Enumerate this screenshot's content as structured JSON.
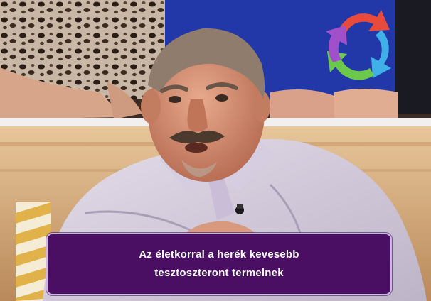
{
  "icons": {
    "logo": "recycle-arrows-icon"
  },
  "colors": {
    "subtitle_background": "#4a0f63",
    "subtitle_border": "#c9b8e6",
    "subtitle_text": "#ffffff"
  },
  "subtitle": {
    "line1": "Az életkorral a herék kevesebb",
    "line2": "tesztoszteront termelnek"
  }
}
